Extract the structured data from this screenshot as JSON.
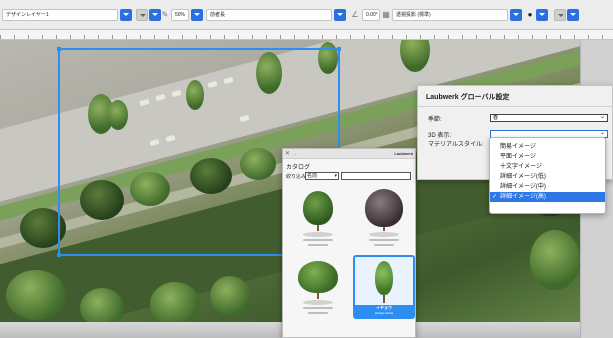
{
  "toolbar": {
    "layer": "デザインレイヤー1",
    "zoom": "50%",
    "class_label": "前者長",
    "rotation": "0.00°",
    "view": "透視投影 (標準)"
  },
  "settings": {
    "title": "Laubwerk グローバル設定",
    "season_label": "季節:",
    "season_value": "春",
    "display_label": "3D 表示:",
    "material_label": "マテリアルスタイル:",
    "display_options": [
      "簡易イメージ",
      "平面イメージ",
      "十文字イメージ",
      "詳細イメージ(低)",
      "詳細イメージ(中)",
      "詳細イメージ(高)"
    ],
    "display_selected": "詳細イメージ(高)"
  },
  "catalog": {
    "close_glyph": "✕",
    "menu_glyph": "…",
    "title": "Laubwerk",
    "heading": "カタログ",
    "filter_label": "絞り込み:",
    "filter_value": "名前",
    "selected_common_name": "イチョウ",
    "selected_latin_name": "Ginkgo biloba"
  },
  "colors": {
    "accent": "#2d8df0",
    "selected_item": "#2d78e6"
  }
}
